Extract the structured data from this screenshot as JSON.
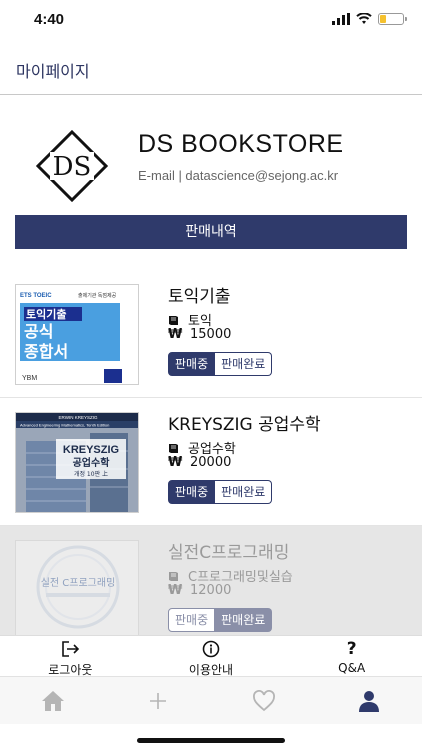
{
  "status": {
    "time": "4:40"
  },
  "nav": {
    "title": "마이페이지"
  },
  "profile": {
    "store_name": "DS BOOKSTORE",
    "email": "E-mail | datascience@sejong.ac.kr",
    "logo_text": "DS"
  },
  "sales_tab": {
    "label": "판매내역"
  },
  "items": [
    {
      "title": "토익기출",
      "category": "토익",
      "price": "15000",
      "status_on": "판매중",
      "status_done": "판매완료",
      "sold": false,
      "cover_text": [
        "ETS TOEIC",
        "출제기관 독점제공",
        "토익기출",
        "공식",
        "종합서",
        "YBM"
      ]
    },
    {
      "title": "KREYSZIG 공업수학",
      "category": "공업수학",
      "price": "20000",
      "status_on": "판매중",
      "status_done": "판매완료",
      "sold": false,
      "cover_text": [
        "ERWIN KREYSZIG",
        "Advanced Engineering Mathematics, Tenth Edition",
        "KREYSZIG",
        "공업수학",
        "개정 10판 上"
      ]
    },
    {
      "title": "실전C프로그래밍",
      "category": "C프로그래밍및실습",
      "price": "12000",
      "status_on": "판매중",
      "status_done": "판매완료",
      "sold": true,
      "cover_text": [
        "실전 C프로그래밍"
      ]
    }
  ],
  "actions": [
    {
      "label": "로그아웃",
      "icon": "logout-icon"
    },
    {
      "label": "이용안내",
      "icon": "info-icon"
    },
    {
      "label": "Q&A",
      "icon": "question-icon"
    }
  ],
  "tabbar": [
    {
      "icon": "home-icon",
      "active": false
    },
    {
      "icon": "plus-icon",
      "active": false
    },
    {
      "icon": "heart-icon",
      "active": false
    },
    {
      "icon": "person-icon",
      "active": true
    }
  ],
  "colors": {
    "accent": "#2f3a6b",
    "battery": "#f5c12e"
  },
  "battery_level": 0.25
}
